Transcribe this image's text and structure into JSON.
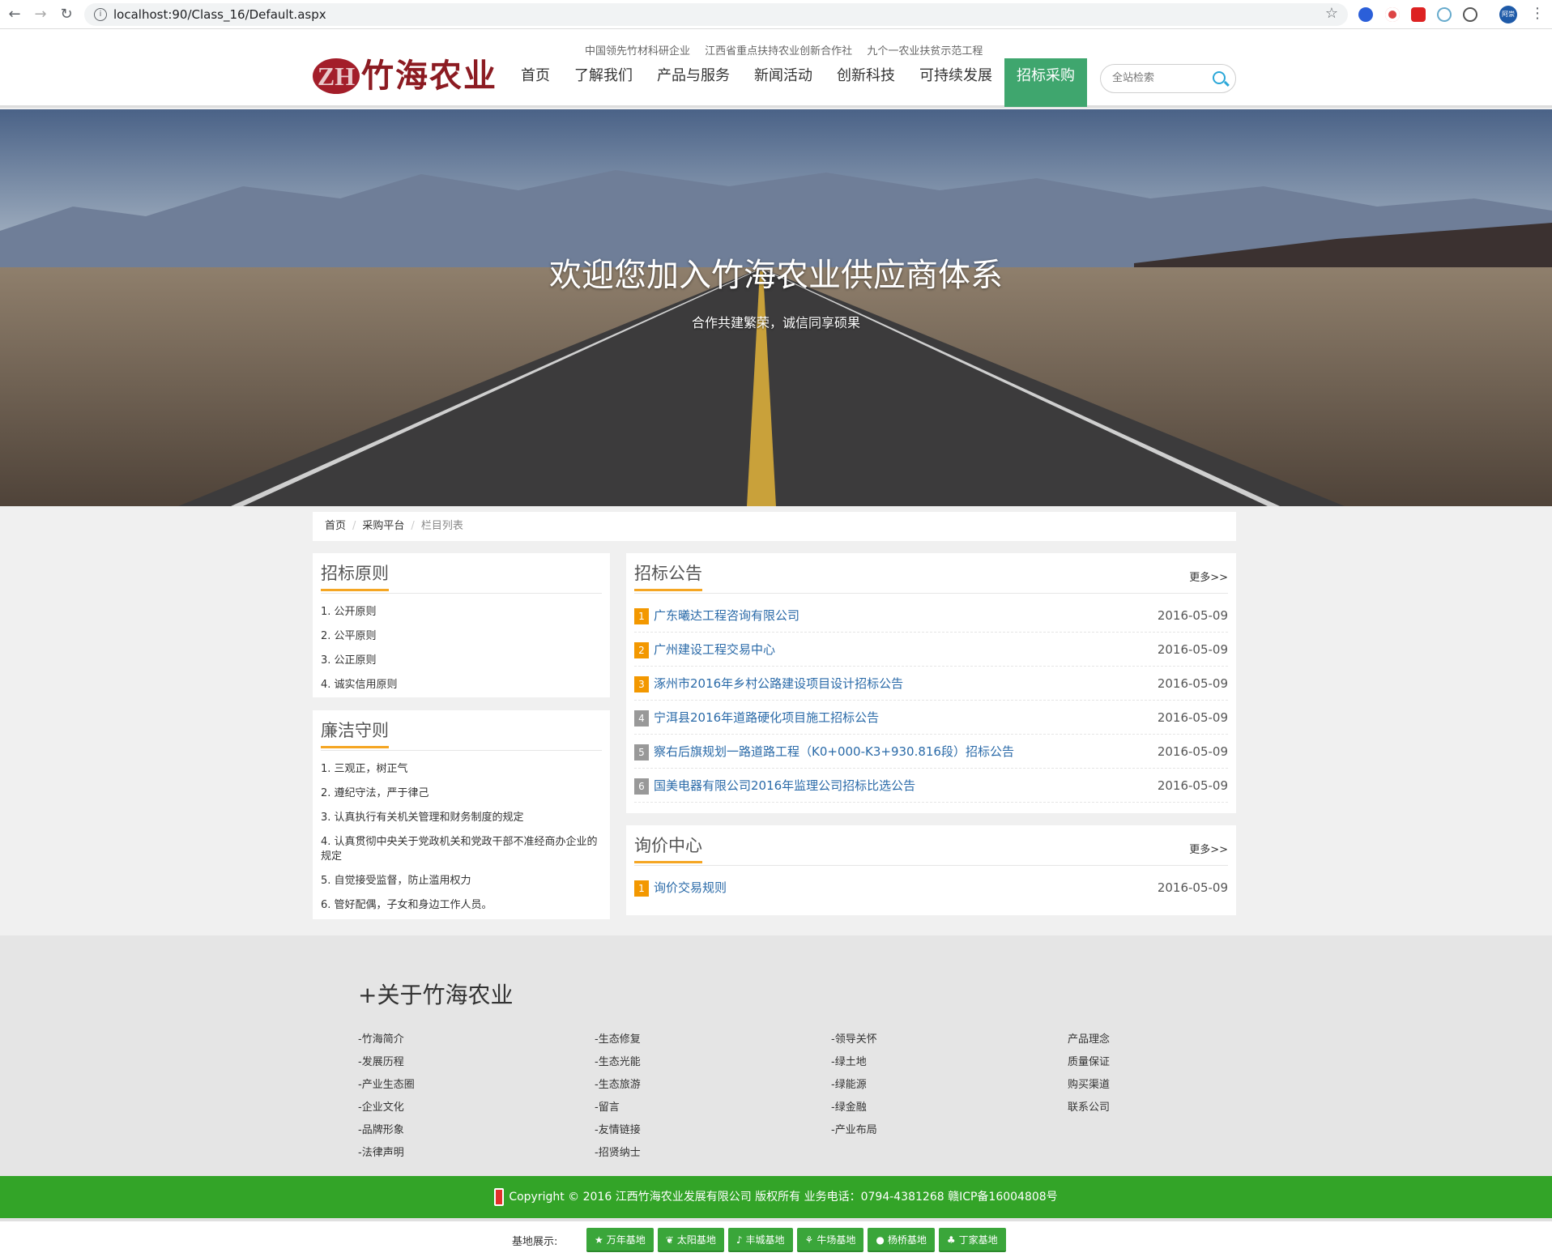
{
  "browser": {
    "url": "localhost:90/Class_16/Default.aspx",
    "avatar_text": "阿崇"
  },
  "header": {
    "taglines": [
      "中国领先竹材科研企业",
      "江西省重点扶持农业创新合作社",
      "九个一农业扶贫示范工程"
    ],
    "logo": {
      "mark": "ZH",
      "name": "竹海农业"
    },
    "nav": [
      "首页",
      "了解我们",
      "产品与服务",
      "新闻活动",
      "创新科技",
      "可持续发展",
      "招标采购"
    ],
    "active_nav": "招标采购",
    "search_placeholder": "全站检索"
  },
  "banner": {
    "title": "欢迎您加入竹海农业供应商体系",
    "subtitle": "合作共建繁荣，诚信同享硕果"
  },
  "breadcrumb": [
    "首页",
    "采购平台",
    "栏目列表"
  ],
  "principles": {
    "title": "招标原则",
    "items": [
      "1. 公开原则",
      "2. 公平原则",
      "3. 公正原则",
      "4. 诚实信用原则"
    ]
  },
  "integrity": {
    "title": "廉洁守则",
    "items": [
      "1. 三观正，树正气",
      "2. 遵纪守法，严于律己",
      "3. 认真执行有关机关管理和财务制度的规定",
      "4. 认真贯彻中央关于党政机关和党政干部不准经商办企业的规定",
      "5. 自觉接受监督，防止滥用权力",
      "6. 管好配偶，子女和身边工作人员。"
    ]
  },
  "notices": {
    "title": "招标公告",
    "more": "更多>>",
    "items": [
      {
        "num": "1",
        "title": "广东曦达工程咨询有限公司",
        "date": "2016-05-09"
      },
      {
        "num": "2",
        "title": "广州建设工程交易中心",
        "date": "2016-05-09"
      },
      {
        "num": "3",
        "title": "涿州市2016年乡村公路建设项目设计招标公告",
        "date": "2016-05-09"
      },
      {
        "num": "4",
        "title": "宁洱县2016年道路硬化项目施工招标公告",
        "date": "2016-05-09"
      },
      {
        "num": "5",
        "title": "察右后旗规划一路道路工程（K0+000-K3+930.816段）招标公告",
        "date": "2016-05-09"
      },
      {
        "num": "6",
        "title": "国美电器有限公司2016年监理公司招标比选公告",
        "date": "2016-05-09"
      }
    ]
  },
  "inquiry": {
    "title": "询价中心",
    "more": "更多>>",
    "items": [
      {
        "num": "1",
        "title": "询价交易规则",
        "date": "2016-05-09"
      }
    ]
  },
  "footer": {
    "title": "+关于竹海农业",
    "col1": [
      "-竹海简介",
      "-发展历程",
      "-产业生态圈",
      "-企业文化",
      "-品牌形象",
      "-法律声明"
    ],
    "col2": [
      "-生态修复",
      "-生态光能",
      "-生态旅游",
      "-留言",
      "-友情链接",
      "-招贤纳士"
    ],
    "col3": [
      "-领导关怀",
      "-绿土地",
      "-绿能源",
      "-绿金融",
      "-产业布局"
    ],
    "col4": [
      "产品理念",
      "质量保证",
      "购买渠道",
      "联系公司"
    ],
    "copyright": "Copyright © 2016 江西竹海农业发展有限公司 版权所有 业务电话：0794-4381268 赣ICP备16004808号",
    "bases_label": "基地展示:",
    "bases": [
      {
        "icon": "star-icon",
        "label": "万年基地"
      },
      {
        "icon": "leaf-icon",
        "label": "太阳基地"
      },
      {
        "icon": "bell-icon",
        "label": "丰城基地"
      },
      {
        "icon": "wheat-icon",
        "label": "牛场基地"
      },
      {
        "icon": "globe-icon",
        "label": "杨桥基地"
      },
      {
        "icon": "tree-icon",
        "label": "丁家基地"
      }
    ]
  },
  "colors": {
    "accent_green": "#3fa66e",
    "underline_orange": "#f5a623",
    "bar_green": "#33a428",
    "link_blue": "#2a6aa8"
  }
}
